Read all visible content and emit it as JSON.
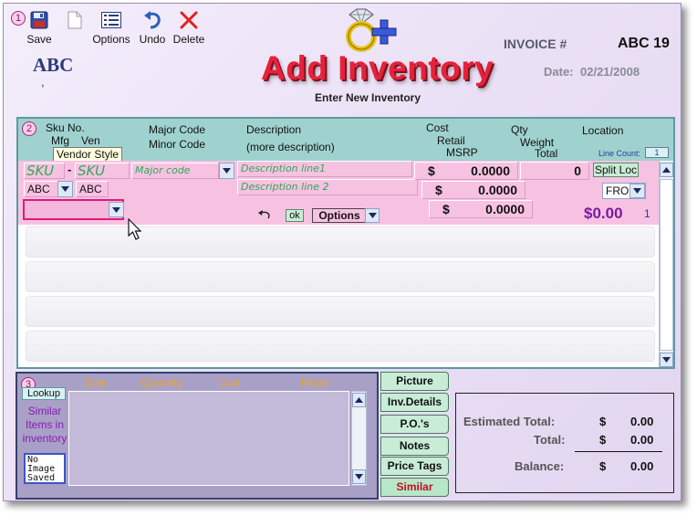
{
  "section_numbers": [
    "1",
    "2",
    "3"
  ],
  "toolbar": [
    {
      "label": "Save",
      "icon": "floppy-disk-icon"
    },
    {
      "label": "",
      "icon": "document-icon"
    },
    {
      "label": "Options",
      "icon": "list-icon"
    },
    {
      "label": "Undo",
      "icon": "undo-icon"
    },
    {
      "label": "Delete",
      "icon": "delete-x-icon"
    }
  ],
  "company": {
    "name": "ABC",
    "sub": ","
  },
  "title": "Add Inventory",
  "subtitle": "Enter New Inventory",
  "invoice": {
    "label": "INVOICE #",
    "value": "ABC 19"
  },
  "date": {
    "label": "Date:",
    "value": "02/21/2008"
  },
  "grid_header": {
    "sku": "Sku No.",
    "mfg": "Mfg",
    "ven": "Ven",
    "vendor_style": "Vendor Style",
    "major_code": "Major Code",
    "minor_code": "Minor Code",
    "description": "Description",
    "more_description": "(more description)",
    "cost": "Cost",
    "retail": "Retail",
    "msrp": "MSRP",
    "qty": "Qty",
    "weight": "Weight",
    "total": "Total",
    "location": "Location",
    "line_count_label": "Line Count:",
    "line_count": "1"
  },
  "entry": {
    "sku1_placeholder": "SKU",
    "separator": "-",
    "sku2_placeholder": "SKU",
    "major_code_placeholder": "Major code",
    "desc1_placeholder": "Description line1",
    "desc2_placeholder": "Description line 2",
    "mfg_value": "ABC",
    "ven_value": "ABC",
    "cost_currency": "$",
    "cost_value": "0.0000",
    "retail_currency": "$",
    "retail_value": "0.0000",
    "msrp_currency": "$",
    "msrp_value": "0.0000",
    "qty_value": "0",
    "split_loc": "Split Loc",
    "location_value": "FRO",
    "ok_label": "ok",
    "options_label": "Options",
    "line_total": "$0.00",
    "line_number": "1"
  },
  "similar_panel": {
    "columns": [
      "Date",
      "Quantity",
      "Cost",
      "Retail"
    ],
    "lookup": "Lookup",
    "similar_text": "Similar Items in inventory",
    "no_image": "No Image Saved"
  },
  "tabs": [
    "Picture",
    "Inv.Details",
    "P.O.'s",
    "Notes",
    "Price Tags",
    "Similar"
  ],
  "active_tab": "Similar",
  "totals": [
    {
      "label": "Estimated Total:",
      "currency": "$",
      "value": "0.00"
    },
    {
      "label": "Total:",
      "currency": "$",
      "value": "0.00"
    },
    {
      "label": "Balance:",
      "currency": "$",
      "value": "0.00"
    }
  ],
  "colors": {
    "title_red": "#e8203a",
    "header_teal": "#9fd2cf",
    "entry_pink": "#f7c2e2",
    "placeholder_green": "#2faa55",
    "line_total_purple": "#7a1aa0",
    "column_header_orange": "#e5a52c"
  }
}
